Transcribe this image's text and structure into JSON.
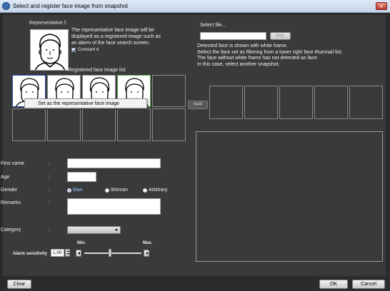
{
  "window": {
    "title": "Select and register face image from snapshot",
    "close_glyph": "×"
  },
  "representative": {
    "label": "Representative f:",
    "description": [
      "The representative face image will be",
      "displayed as a registered image such as",
      "an alarm of the face search screen."
    ],
    "constant_label": "Constant d"
  },
  "registered": {
    "label": "Registered face image list"
  },
  "context_menu": {
    "item": "Set as the representative face image"
  },
  "file": {
    "label": "Select file…",
    "path_value": "",
    "ref_button": "Ref."
  },
  "instructions": [
    "Detected face is shown with white frame.",
    "Select the face set as filtering from a lower right face thumnail list.",
    "The face without white frame has not detected as face.",
    "In this case, select another snapshot."
  ],
  "transfer_button": "<==",
  "form": {
    "separator": ":",
    "first_name_label": "First name",
    "first_name_value": "",
    "age_label": "Age",
    "age_value": "",
    "gender_label": "Gender",
    "gender_options": [
      "Man",
      "Woman",
      "Arbitrary"
    ],
    "gender_selected": "Man",
    "remarks_label": "Remarks",
    "remarks_value": "",
    "category_label": "Category",
    "category_value": ""
  },
  "alarm": {
    "label": "Alarm sensitivity",
    "value": "1.00",
    "min_label": "Min.",
    "max_label": "Max.",
    "slider_level": 0.45
  },
  "buttons": {
    "clear": "Clear",
    "ok": "OK",
    "cancel": "Cancel"
  },
  "icons": {
    "app": "face-app-icon",
    "close": "close-icon",
    "checkbox": "checkbox-checked-icon",
    "dropdown": "chevron-down-icon",
    "spin": "spin-arrows-icon",
    "slider_left": "arrow-left-icon",
    "slider_right": "arrow-right-icon"
  }
}
